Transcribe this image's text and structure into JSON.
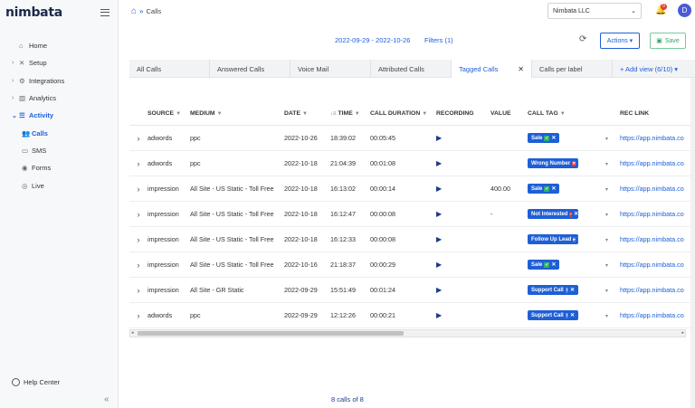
{
  "app": {
    "logo": "nimbata"
  },
  "sidebar": {
    "items": [
      {
        "label": "Home",
        "icon": "home-icon",
        "glyph": "⌂",
        "chevron": ""
      },
      {
        "label": "Setup",
        "icon": "tools-icon",
        "glyph": "✕",
        "chevron": "›"
      },
      {
        "label": "Integrations",
        "icon": "gear-icon",
        "glyph": "⚙",
        "chevron": "›"
      },
      {
        "label": "Analytics",
        "icon": "bar-chart-icon",
        "glyph": "▥",
        "chevron": "›"
      },
      {
        "label": "Activity",
        "icon": "list-icon",
        "glyph": "☰",
        "chevron": "⌄"
      }
    ],
    "subitems": [
      {
        "label": "Calls",
        "icon": "users-icon",
        "glyph": "👥"
      },
      {
        "label": "SMS",
        "icon": "chat-icon",
        "glyph": "▭"
      },
      {
        "label": "Forms",
        "icon": "eye-icon",
        "glyph": "◉"
      },
      {
        "label": "Live",
        "icon": "broadcast-icon",
        "glyph": "◎"
      }
    ],
    "help": "Help Center"
  },
  "header": {
    "breadcrumb_current": "Calls",
    "org": "Nimbata LLC",
    "notifications": "0",
    "avatar": "D"
  },
  "toolbar": {
    "date_range": "2022-09-29 - 2022-10-26",
    "filters": "Filters (1)",
    "actions": "Actions ▾",
    "save": "Save"
  },
  "tabs": [
    {
      "label": "All Calls",
      "active": false,
      "closable": false
    },
    {
      "label": "Answered Calls",
      "active": false,
      "closable": false
    },
    {
      "label": "Voice Mail",
      "active": false,
      "closable": false
    },
    {
      "label": "Attributed Calls",
      "active": false,
      "closable": false
    },
    {
      "label": "Tagged Calls",
      "active": true,
      "closable": true
    },
    {
      "label": "Calls per label",
      "active": false,
      "closable": false
    }
  ],
  "add_view": "+ Add view (6/10) ▾",
  "columns": [
    "SOURCE",
    "MEDIUM",
    "DATE",
    "TIME",
    "CALL DURATION",
    "RECORDING",
    "VALUE",
    "CALL TAG",
    "",
    "REC LINK"
  ],
  "rows": [
    {
      "source": "adwords",
      "medium": "ppc",
      "date": "2022-10-26",
      "time": "18:39:02",
      "duration": "00:05:45",
      "value": "",
      "tag": "Sale",
      "tag_icon": "✓",
      "tag_color": "#2fb36d",
      "rec": "https://app.nimbata.co"
    },
    {
      "source": "adwords",
      "medium": "ppc",
      "date": "2022-10-18",
      "time": "21:04:39",
      "duration": "00:01:08",
      "value": "",
      "tag": "Wrong Number",
      "tag_icon": "✕",
      "tag_color": "#e23b3b",
      "rec": "https://app.nimbata.co"
    },
    {
      "source": "impression",
      "medium": "All Site - US Static - Toll Free",
      "date": "2022-10-18",
      "time": "16:13:02",
      "duration": "00:00:14",
      "value": "400.00",
      "tag": "Sale",
      "tag_icon": "✓",
      "tag_color": "#2fb36d",
      "rec": "https://app.nimbata.co"
    },
    {
      "source": "impression",
      "medium": "All Site - US Static - Toll Free",
      "date": "2022-10-18",
      "time": "16:12:47",
      "duration": "00:00:08",
      "value": "-",
      "tag": "Not Interested",
      "tag_icon": "–",
      "tag_color": "#e23b3b",
      "rec": "https://app.nimbata.co"
    },
    {
      "source": "impression",
      "medium": "All Site - US Static - Toll Free",
      "date": "2022-10-18",
      "time": "16:12:33",
      "duration": "00:00:08",
      "value": "",
      "tag": "Follow Up Lead",
      "tag_icon": "▸",
      "tag_color": "#3d7bf0",
      "rec": "https://app.nimbata.co"
    },
    {
      "source": "impression",
      "medium": "All Site - US Static - Toll Free",
      "date": "2022-10-16",
      "time": "21:18:37",
      "duration": "00:00:29",
      "value": "",
      "tag": "Sale",
      "tag_icon": "✓",
      "tag_color": "#2fb36d",
      "rec": "https://app.nimbata.co"
    },
    {
      "source": "impression",
      "medium": "All Site - GR Static",
      "date": "2022-09-29",
      "time": "15:51:49",
      "duration": "00:01:24",
      "value": "",
      "tag": "Support Call",
      "tag_icon": "i",
      "tag_color": "#3d7bf0",
      "rec": "https://app.nimbata.co"
    },
    {
      "source": "adwords",
      "medium": "ppc",
      "date": "2022-09-29",
      "time": "12:12:26",
      "duration": "00:00:21",
      "value": "",
      "tag": "Support Call",
      "tag_icon": "i",
      "tag_color": "#3d7bf0",
      "rec": "https://app.nimbata.co"
    }
  ],
  "footer": {
    "count": "8 calls of 8"
  }
}
